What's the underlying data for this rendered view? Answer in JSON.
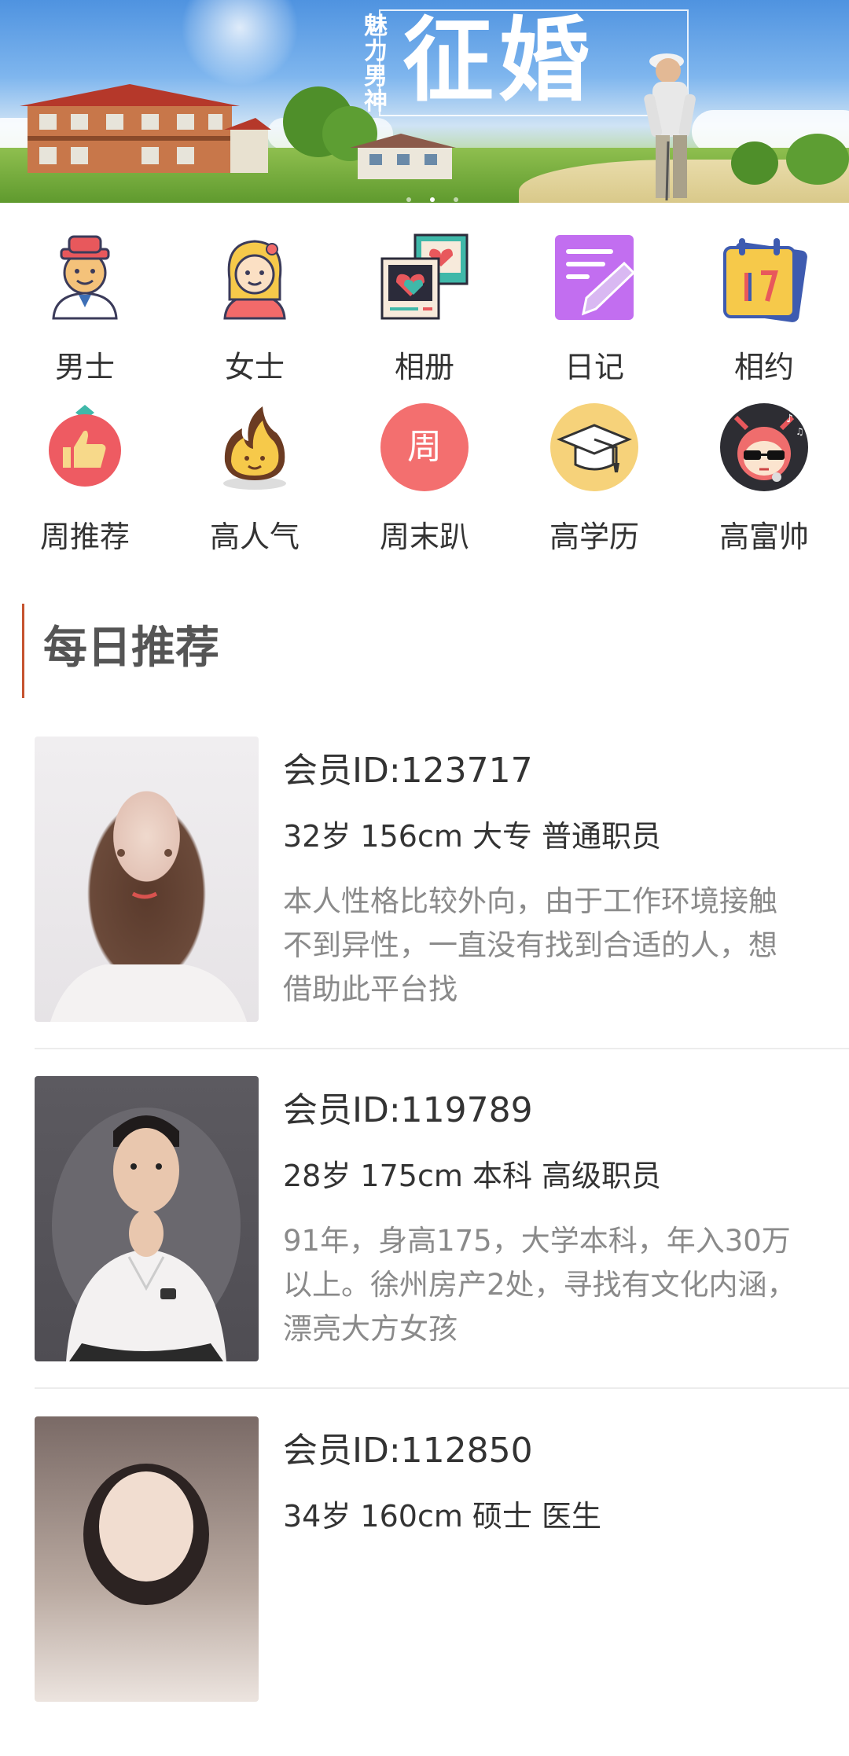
{
  "banner": {
    "tagline": "魅力男神",
    "headline": "征婚",
    "dots": 3,
    "active_dot": 1
  },
  "categories": [
    {
      "label": "男士",
      "icon": "man-icon"
    },
    {
      "label": "女士",
      "icon": "woman-icon"
    },
    {
      "label": "相册",
      "icon": "photo-album-icon"
    },
    {
      "label": "日记",
      "icon": "diary-icon"
    },
    {
      "label": "相约",
      "icon": "calendar-icon"
    },
    {
      "label": "周推荐",
      "icon": "thumbs-up-icon"
    },
    {
      "label": "高人气",
      "icon": "fire-icon"
    },
    {
      "label": "周末趴",
      "icon": "weekend-badge-icon",
      "badge_text": "周"
    },
    {
      "label": "高学历",
      "icon": "graduation-cap-icon"
    },
    {
      "label": "高富帅",
      "icon": "cool-guy-icon"
    }
  ],
  "section": {
    "title": "每日推荐"
  },
  "members": [
    {
      "id_label": "会员ID:123717",
      "meta": "32岁 156cm 大专 普通职员",
      "desc": "本人性格比较外向，由于工作环境接触不到异性，一直没有找到合适的人，想借助此平台找"
    },
    {
      "id_label": "会员ID:119789",
      "meta": "28岁 175cm 本科 高级职员",
      "desc": "91年，身高175，大学本科，年入30万以上。徐州房产2处，寻找有文化内涵，漂亮大方女孩"
    },
    {
      "id_label": "会员ID:112850",
      "meta": "34岁 160cm 硕士 医生",
      "desc": ""
    }
  ],
  "colors": {
    "accent": "#c6532f",
    "text": "#333333",
    "muted": "#8a8a8a"
  }
}
